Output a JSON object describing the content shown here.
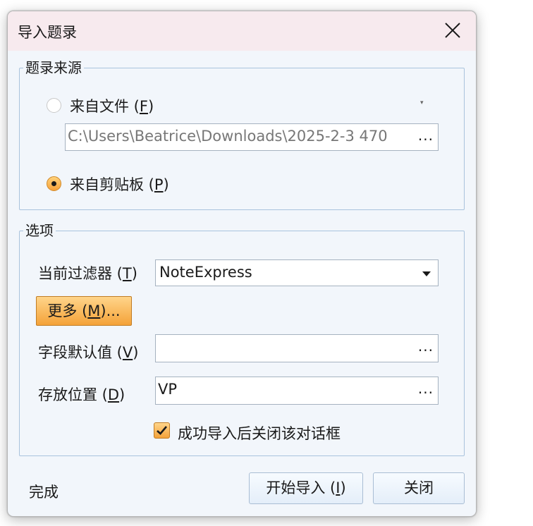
{
  "dialog": {
    "title": "导入题录"
  },
  "source": {
    "legend": "题录来源",
    "from_file": {
      "label": "来自文件 (",
      "key": "F",
      "suffix": ")",
      "selected": false
    },
    "file_path": "C:\\Users\\Beatrice\\Downloads\\2025-2-3 470",
    "browse_label": "...",
    "from_clipboard": {
      "label": "来自剪贴板 (",
      "key": "P",
      "suffix": ")",
      "selected": true
    }
  },
  "options": {
    "legend": "选项",
    "filter": {
      "label": "当前过滤器 (",
      "key": "T",
      "suffix": ")",
      "value": "NoteExpress"
    },
    "more": {
      "label": "更多 (",
      "key": "M",
      "suffix": ")..."
    },
    "defaults": {
      "label": "字段默认值 (",
      "key": "V",
      "suffix": ")",
      "value": "",
      "browse_label": "..."
    },
    "location": {
      "label": "存放位置 (",
      "key": "D",
      "suffix": ")",
      "value": "VP",
      "browse_label": "..."
    },
    "close_after": {
      "label": "成功导入后关闭该对话框",
      "checked": true
    }
  },
  "footer": {
    "status": "完成",
    "start": {
      "label": "开始导入 (",
      "key": "I",
      "suffix": ")"
    },
    "close": "关闭"
  },
  "colors": {
    "accent": "#f4a239",
    "group_border": "#a9c3dd",
    "titlebar": "#f7eaee"
  },
  "icons": {
    "close": "close-icon",
    "check": "check-icon",
    "dropdown": "chevron-down-icon"
  }
}
